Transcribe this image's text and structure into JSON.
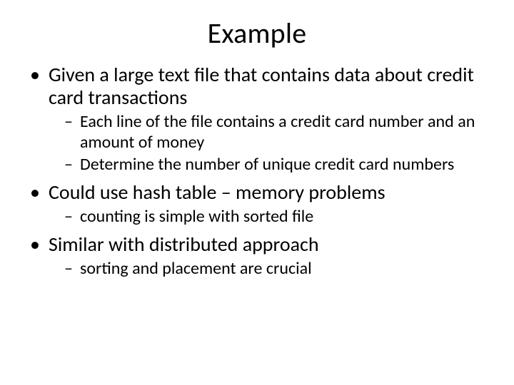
{
  "title": "Example",
  "bullets": [
    {
      "text": "Given a large text file that contains data about credit card transactions",
      "sub": [
        "Each line of the file contains a credit card number and an amount of money",
        "Determine the number of unique credit card numbers"
      ]
    },
    {
      "text": "Could use hash table – memory problems",
      "sub": [
        "counting is simple with sorted file"
      ]
    },
    {
      "text": "Similar with distributed approach",
      "sub": [
        "sorting and placement are crucial"
      ]
    }
  ]
}
